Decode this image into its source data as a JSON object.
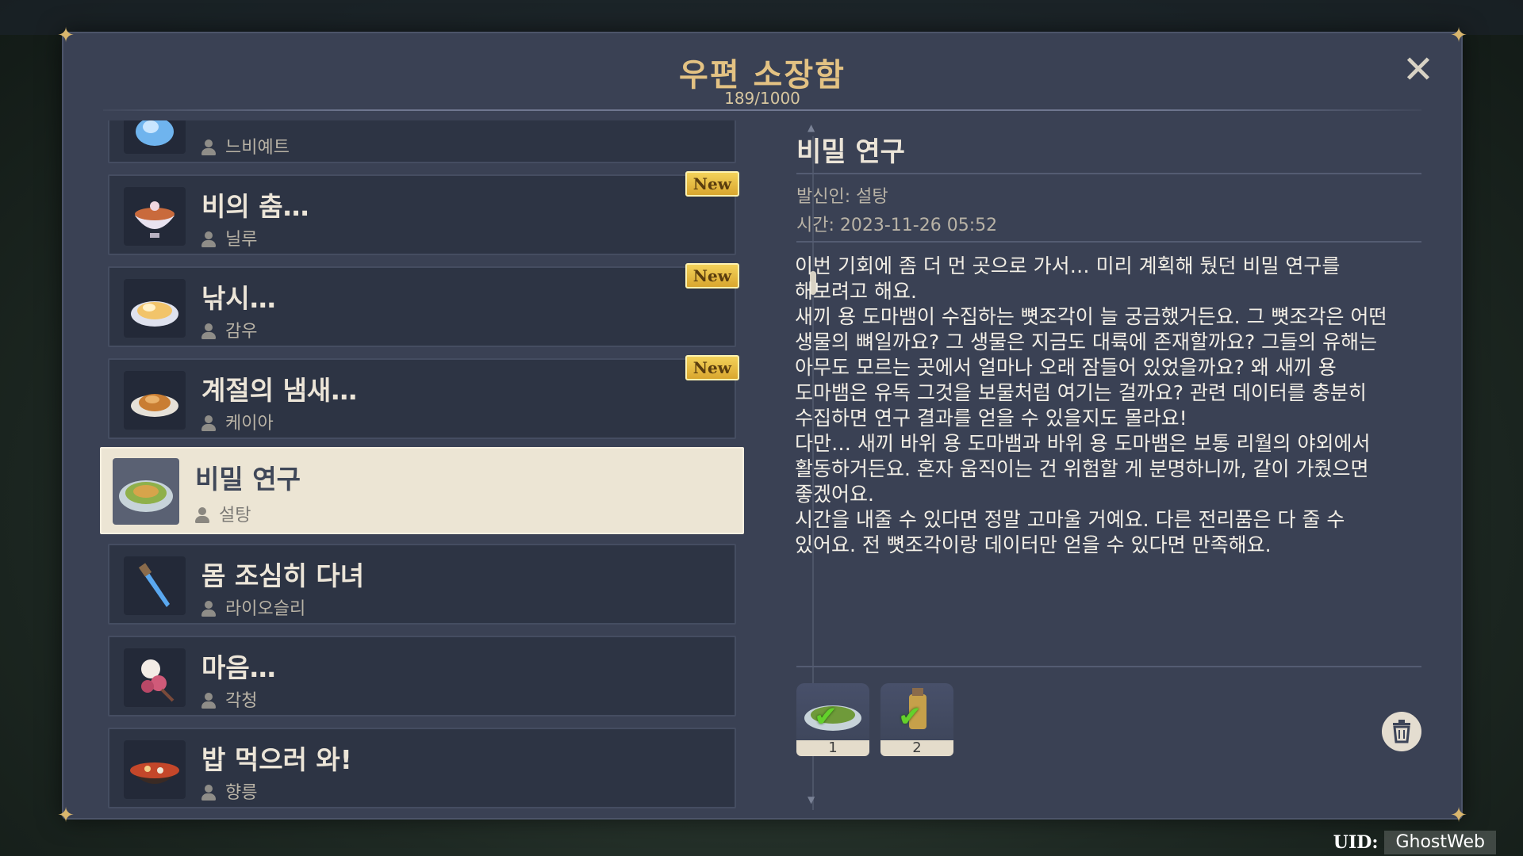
{
  "window": {
    "title": "우편 소장함",
    "count": "189/1000"
  },
  "mail_list": [
    {
      "subject": "",
      "sender": "느비예트",
      "new": false,
      "icon": "crystal-icon"
    },
    {
      "subject": "비의 춤…",
      "sender": "닐루",
      "new": true,
      "new_label": "New",
      "icon": "dessert-bowl-icon"
    },
    {
      "subject": "낚시…",
      "sender": "감우",
      "new": true,
      "new_label": "New",
      "icon": "dumpling-plate-icon"
    },
    {
      "subject": "계절의 냄새…",
      "sender": "케이아",
      "new": true,
      "new_label": "New",
      "icon": "roast-dish-icon"
    },
    {
      "subject": "비밀 연구",
      "sender": "설탕",
      "new": false,
      "icon": "stew-plate-icon",
      "selected": true
    },
    {
      "subject": "몸 조심히 다녀",
      "sender": "라이오슬리",
      "new": false,
      "icon": "dagger-icon"
    },
    {
      "subject": "마음…",
      "sender": "각청",
      "new": false,
      "icon": "flower-icon"
    },
    {
      "subject": "밥 먹으러 와!",
      "sender": "향릉",
      "new": false,
      "icon": "hotpot-icon"
    }
  ],
  "detail": {
    "title": "비밀 연구",
    "sender": "발신인: 설탕",
    "time": "시간: 2023-11-26 05:52",
    "body": "이번 기회에 좀 더 먼 곳으로 가서… 미리 계획해 뒀던 비밀 연구를\n해보려고 해요.\n새끼 용 도마뱀이 수집하는 뼛조각이 늘 궁금했거든요. 그 뼛조각은 어떤\n생물의 뼈일까요? 그 생물은 지금도 대륙에 존재할까요? 그들의 유해는\n아무도 모르는 곳에서 얼마나 오래 잠들어 있었을까요? 왜 새끼 용\n도마뱀은 유독 그것을 보물처럼 여기는 걸까요? 관련 데이터를 충분히\n수집하면 연구 결과를 얻을 수 있을지도 몰라요!\n다만… 새끼 바위 용 도마뱀과 바위 용 도마뱀은 보통 리월의 야외에서\n활동하거든요. 혼자 움직이는 건 위험할 게 분명하니까, 같이 가줬으면\n좋겠어요.\n시간을 내줄 수 있다면 정말 고마울 거예요. 다른 전리품은 다 줄 수\n있어요. 전 뼛조각이랑 데이터만 얻을 수 있다면 만족해요.",
    "attachments": [
      {
        "count": "1",
        "icon": "stew-dish-icon",
        "claimed": true
      },
      {
        "count": "2",
        "icon": "lantern-potion-icon",
        "claimed": true
      }
    ]
  },
  "uid": {
    "label": "UID:",
    "value": "GhostWeb"
  },
  "colors": {
    "panel": "#3a4154",
    "title_gold": "#e3c283",
    "new_badge": "#f3d25a",
    "selected_bg": "#ece5d4",
    "check": "#63d12b"
  }
}
